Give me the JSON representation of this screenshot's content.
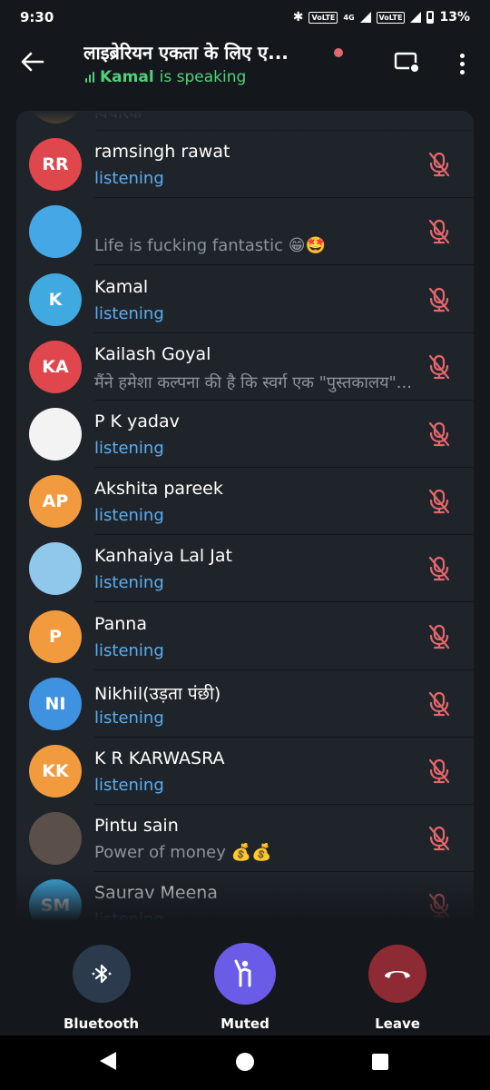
{
  "status_bar": {
    "time": "9:30",
    "net1": "VoLTE",
    "net2": "4G",
    "net3": "VoLTE",
    "battery": "13%"
  },
  "header": {
    "title": "लाइब्रेरियन एकता के लिए ए...",
    "speaker_name": "Kamal",
    "speaking_suffix": "is speaking"
  },
  "participants": [
    {
      "name": "",
      "status": "विचारक",
      "initials": "",
      "avatar_color": "#8a6a3a",
      "status_style": "grey"
    },
    {
      "name": "ramsingh rawat",
      "status": "listening",
      "initials": "RR",
      "avatar_color": "#e0474c",
      "status_style": "blue"
    },
    {
      "name": "",
      "status": "Life is fucking fantastic 😁🤩",
      "initials": "",
      "avatar_color": "#45a7e6",
      "status_style": "grey"
    },
    {
      "name": "Kamal",
      "status": "listening",
      "initials": "K",
      "avatar_color": "#3fa9e0",
      "status_style": "blue"
    },
    {
      "name": "Kailash Goyal",
      "status": "मैंने हमेशा कल्पना की है कि स्वर्ग एक \"पुस्तकालय\"...",
      "initials": "KA",
      "avatar_color": "#e0474c",
      "status_style": "grey"
    },
    {
      "name": "P K yadav",
      "status": "listening",
      "initials": "",
      "avatar_color": "#f3f3f3",
      "status_style": "blue"
    },
    {
      "name": "Akshita pareek",
      "status": "listening",
      "initials": "AP",
      "avatar_color": "#f29b3e",
      "status_style": "blue"
    },
    {
      "name": "Kanhaiya Lal Jat",
      "status": "listening",
      "initials": "",
      "avatar_color": "#8fc8ea",
      "status_style": "blue"
    },
    {
      "name": "Panna",
      "status": "listening",
      "initials": "P",
      "avatar_color": "#f29b3e",
      "status_style": "blue"
    },
    {
      "name": "Nikhil(उड़ता पंछी)",
      "status": "listening",
      "initials": "NI",
      "avatar_color": "#3f92e0",
      "status_style": "blue"
    },
    {
      "name": "K R KARWASRA",
      "status": "listening",
      "initials": "KK",
      "avatar_color": "#f29b3e",
      "status_style": "blue"
    },
    {
      "name": "Pintu sain",
      "status": "Power of money 💰💰",
      "initials": "",
      "avatar_color": "#5b4f49",
      "status_style": "grey"
    },
    {
      "name": "Saurav Meena",
      "status": "listening",
      "initials": "SM",
      "avatar_color": "#3fa9e0",
      "status_style": "blue"
    }
  ],
  "controls": {
    "bluetooth_label": "Bluetooth",
    "muted_label": "Muted",
    "leave_label": "Leave",
    "bluetooth_color": "#2b3a4d",
    "muted_color": "#6b5ce7",
    "leave_color": "#8e2a33"
  },
  "colors": {
    "muted_mic": "#e5676b",
    "speaking_green": "#4fd27a",
    "listening_blue": "#5aaef0"
  }
}
